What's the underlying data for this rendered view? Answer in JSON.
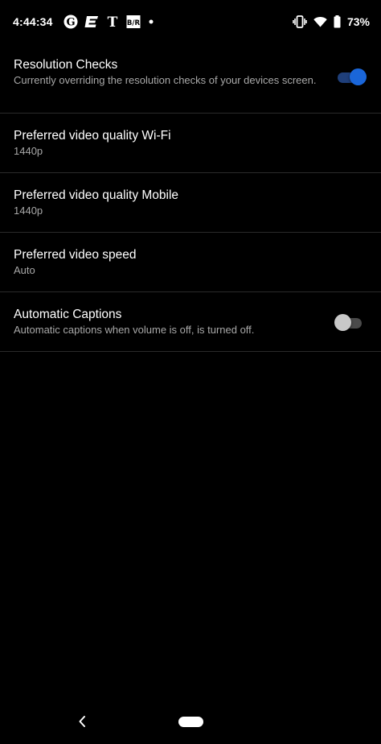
{
  "status_bar": {
    "time": "4:44:34",
    "battery_percent": "73%",
    "notification_icons": [
      "guardian-icon",
      "espn-icon",
      "nyt-icon",
      "bleacher-report-icon",
      "dot-icon"
    ],
    "system_icons": [
      "vibrate-icon",
      "wifi-icon",
      "battery-icon"
    ]
  },
  "settings": [
    {
      "title": "Resolution Checks",
      "summary": "Currently overriding the resolution checks of your devices screen.",
      "toggle": true
    },
    {
      "title": "Preferred video quality Wi-Fi",
      "summary": "1440p"
    },
    {
      "title": "Preferred video quality Mobile",
      "summary": "1440p"
    },
    {
      "title": "Preferred video speed",
      "summary": "Auto"
    },
    {
      "title": "Automatic Captions",
      "summary": "Automatic captions when volume is off, is turned off.",
      "toggle": false
    }
  ],
  "colors": {
    "background": "#000000",
    "accent": "#1a66d9",
    "title_text": "#ffffff",
    "summary_text": "#a8a8a8",
    "divider": "#2a2a2a"
  },
  "nav_bar": {
    "icons": [
      "back-chevron-icon",
      "home-pill-icon"
    ]
  }
}
